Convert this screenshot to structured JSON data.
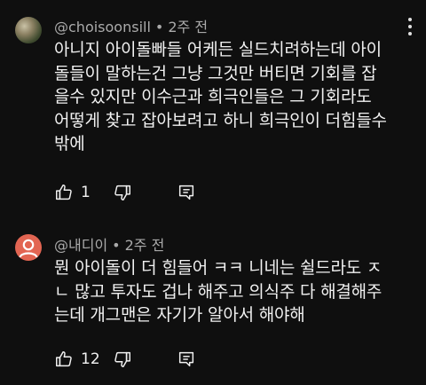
{
  "comments": [
    {
      "author": "@choisoonsill",
      "time": "2주 전",
      "text": "아니지 아이돌빠들 어케든 실드치려하는데 아이\n돌들이 말하는건 그냥 그것만 버티면 기회를 잡\n을수 있지만 이수근과 희극인들은 그 기회라도\n어떻게 찾고 잡아보려고 하니 희극인이 더힘들수\n밖에",
      "likes": "1"
    },
    {
      "author": "@내디이",
      "time": "2주 전",
      "text": "뭔 아이돌이 더 힘들어 ㅋㅋ 니네는 쉴드라도 ㅈ\nㄴ 많고 투자도 겁나 해주고 의식주 다 해결해주\n는데 개그맨은 자기가 알아서 해야해",
      "likes": "12"
    }
  ],
  "ui": {
    "separator": "•"
  },
  "icons": [
    "thumb-up-icon",
    "thumb-down-icon",
    "reply-icon",
    "more-vert-icon",
    "avatar-default-icon"
  ]
}
